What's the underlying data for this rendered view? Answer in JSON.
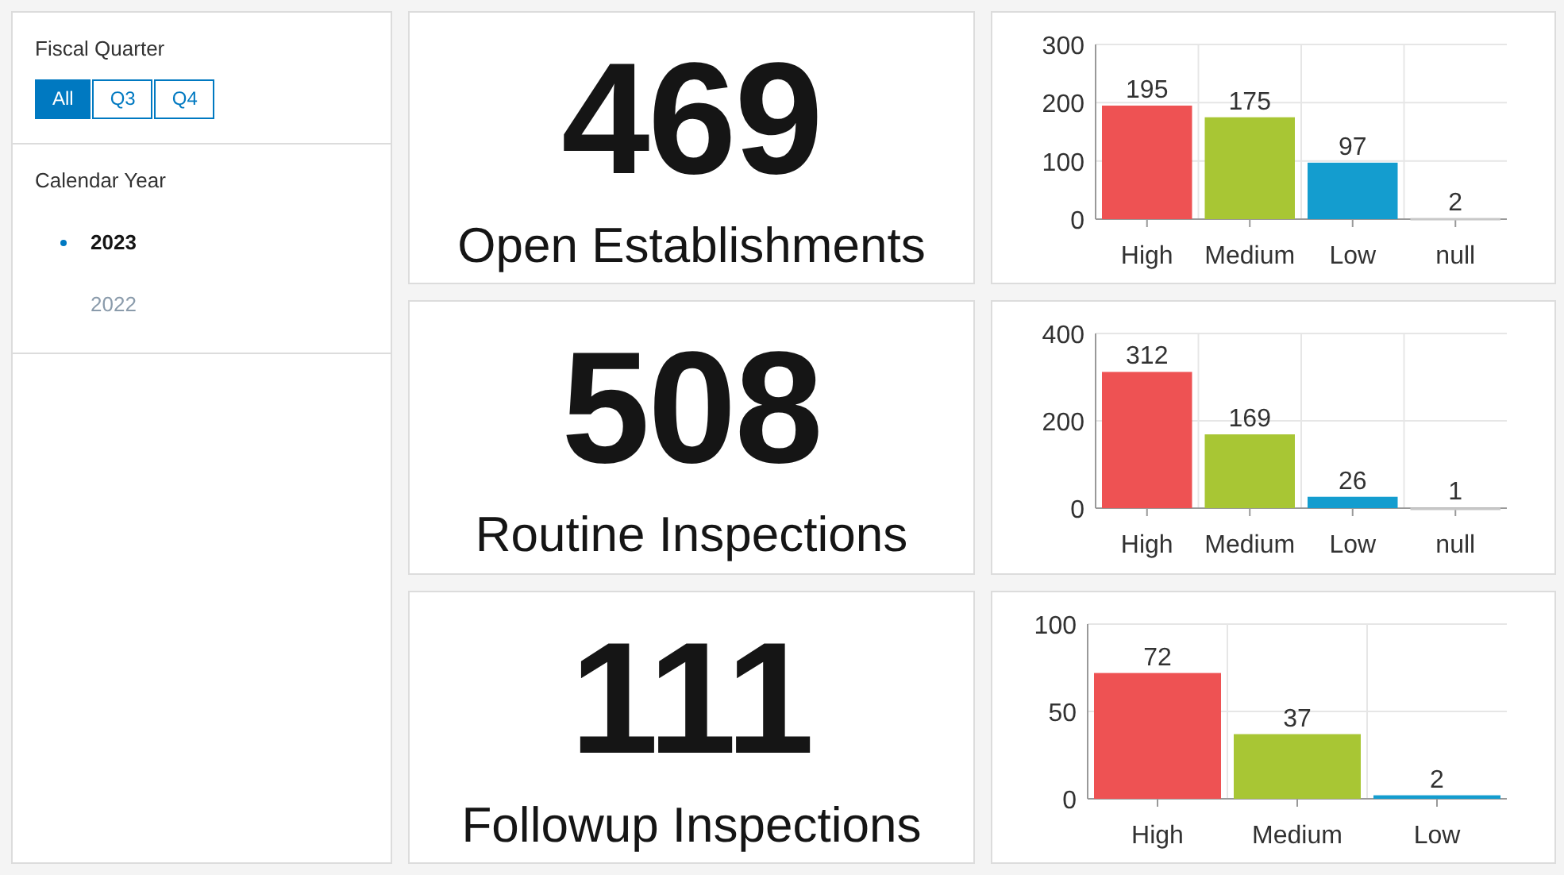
{
  "filters": [
    {
      "title": "Fiscal Quarter",
      "kind": "buttons",
      "options": [
        {
          "label": "All",
          "selected": true
        },
        {
          "label": "Q3",
          "selected": false
        },
        {
          "label": "Q4",
          "selected": false
        }
      ]
    },
    {
      "title": "Calendar Year",
      "kind": "list",
      "options": [
        {
          "label": "2023",
          "selected": true
        },
        {
          "label": "2022",
          "selected": false
        }
      ]
    }
  ],
  "rows": [
    {
      "kpi": {
        "value": "469",
        "label": "Open Establishments"
      },
      "chart_data": {
        "type": "bar",
        "categories": [
          "High",
          "Medium",
          "Low",
          "null"
        ],
        "series": [
          {
            "color": "#ee5253",
            "values": [
              195,
              null,
              null,
              null
            ]
          },
          {
            "color": "#a8c634",
            "values": [
              null,
              175,
              null,
              null
            ]
          },
          {
            "color": "#149dcf",
            "values": [
              null,
              null,
              97,
              null
            ]
          },
          {
            "color": "#c8c8c8",
            "values": [
              null,
              null,
              null,
              2
            ]
          }
        ],
        "ylim": [
          0,
          300
        ],
        "yticks": [
          0,
          100,
          200,
          300
        ],
        "data_labels": true
      }
    },
    {
      "kpi": {
        "value": "508",
        "label": "Routine Inspections"
      },
      "chart_data": {
        "type": "bar",
        "categories": [
          "High",
          "Medium",
          "Low",
          "null"
        ],
        "series": [
          {
            "color": "#ee5253",
            "values": [
              312,
              null,
              null,
              null
            ]
          },
          {
            "color": "#a8c634",
            "values": [
              null,
              169,
              null,
              null
            ]
          },
          {
            "color": "#149dcf",
            "values": [
              null,
              null,
              26,
              null
            ]
          },
          {
            "color": "#c8c8c8",
            "values": [
              null,
              null,
              null,
              1
            ]
          }
        ],
        "ylim": [
          0,
          400
        ],
        "yticks": [
          0,
          200,
          400
        ],
        "data_labels": true
      }
    },
    {
      "kpi": {
        "value": "111",
        "label": "Followup Inspections"
      },
      "chart_data": {
        "type": "bar",
        "categories": [
          "High",
          "Medium",
          "Low"
        ],
        "series": [
          {
            "color": "#ee5253",
            "values": [
              72,
              null,
              null
            ]
          },
          {
            "color": "#a8c634",
            "values": [
              null,
              37,
              null
            ]
          },
          {
            "color": "#149dcf",
            "values": [
              null,
              null,
              2
            ]
          }
        ],
        "ylim": [
          0,
          100
        ],
        "yticks": [
          0,
          50,
          100
        ],
        "data_labels": true
      }
    }
  ]
}
